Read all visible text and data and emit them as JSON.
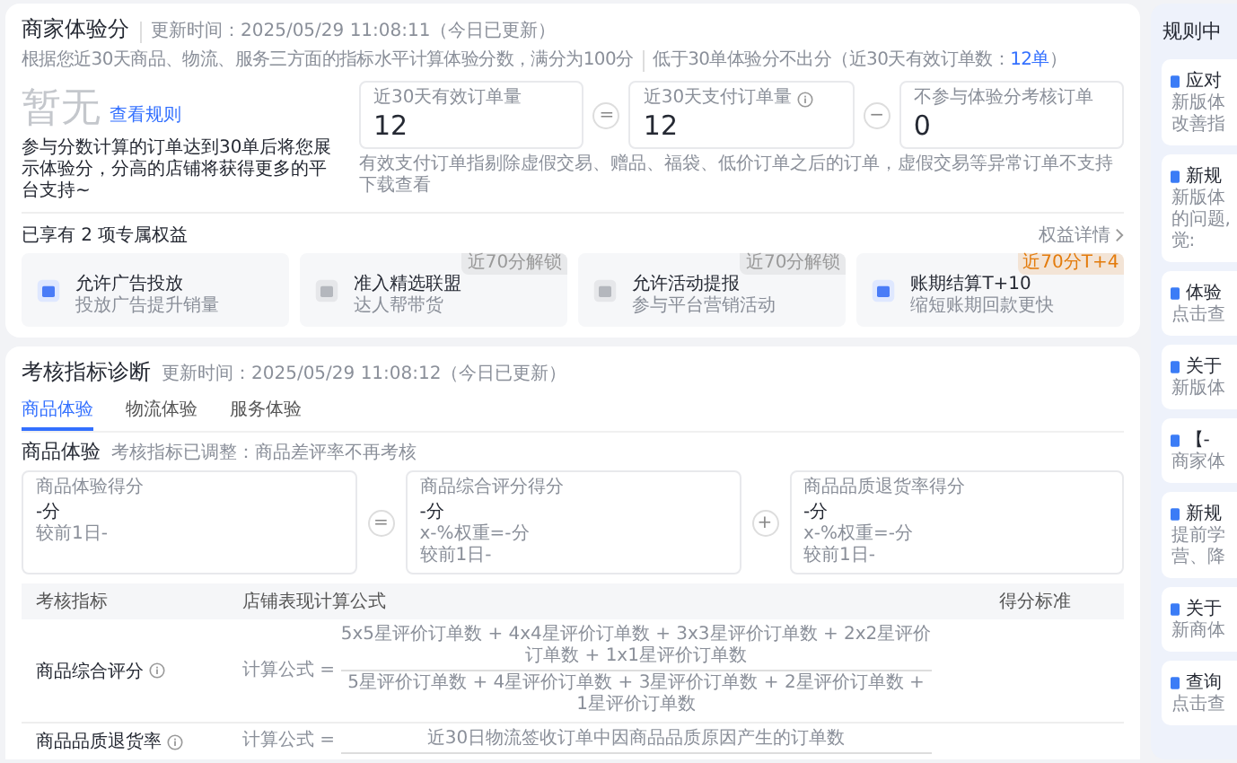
{
  "header": {
    "title": "商家体验分",
    "updated": "更新时间：2025/05/29 11:08:11（今日已更新）",
    "description": "根据您近30天商品、物流、服务三方面的指标水平计算体验分数，满分为100分",
    "threshold": "低于30单体验分不出分（近30天有效订单数：",
    "threshold_link": "12单",
    "threshold_end": "）"
  },
  "score": {
    "value": "暂无",
    "rules_link": "查看规则",
    "note": "参与分数计算的订单达到30单后将您展示体验分，分高的店铺将获得更多的平台支持~"
  },
  "order_formula": {
    "terms": [
      {
        "label": "近30天有效订单量",
        "value": "12",
        "info": false
      },
      {
        "label": "近30天支付订单量",
        "value": "12",
        "info": true
      },
      {
        "label": "不参与体验分考核订单",
        "value": "0",
        "info": false
      }
    ],
    "operators": [
      "=",
      "−"
    ],
    "note": "有效支付订单指剔除虚假交易、赠品、福袋、低价订单之后的订单，虚假交易等异常订单不支持下载查看"
  },
  "benefits": {
    "title": "已享有 2 项专属权益",
    "details_link": "权益详情",
    "items": [
      {
        "title": "允许广告投放",
        "desc": "投放广告提升销量",
        "unlocked": true
      },
      {
        "title": "准入精选联盟",
        "desc": "达人帮带货",
        "unlocked": false,
        "badge": "近70分解锁",
        "color": "#999999"
      },
      {
        "title": "允许活动提报",
        "desc": "参与平台营销活动",
        "unlocked": false,
        "badge": "近70分解锁",
        "color": "#999999"
      },
      {
        "title": "账期结算T+10",
        "desc": "缩短账期回款更快",
        "unlocked": true,
        "badge": "近70分T+4",
        "color": "#e37b0c"
      }
    ]
  },
  "diagnosis": {
    "title": "考核指标诊断",
    "updated": "更新时间：2025/05/29 11:08:12（今日已更新）",
    "tabs": [
      {
        "label": "商品体验",
        "selected": true
      },
      {
        "label": "物流体验",
        "selected": false
      },
      {
        "label": "服务体验",
        "selected": false
      }
    ],
    "section_title": "商品体验",
    "section_note": "考核指标已调整：商品差评率不再考核",
    "scores": [
      {
        "label": "商品体验得分",
        "value": "-分",
        "compare": "较前1日-"
      },
      {
        "label": "商品综合评分得分",
        "value": "-分",
        "weight": "x-%权重=-分",
        "compare": "较前1日-"
      },
      {
        "label": "商品品质退货率得分",
        "value": "-分",
        "weight": "x-%权重=-分",
        "compare": "较前1日-"
      }
    ],
    "operators": [
      "=",
      "+"
    ],
    "table": {
      "columns": [
        "考核指标",
        "店铺表现计算公式",
        "得分标准"
      ],
      "rows": [
        {
          "metric": "商品综合评分",
          "info": true,
          "formula_label": "计算公式 =",
          "numerator": "5x5星评价订单数 + 4x4星评价订单数 + 3x3星评价订单数 + 2x2星评价订单数 + 1x1星评价订单数",
          "denominator": "5星评价订单数 + 4星评价订单数 + 3星评价订单数 + 2星评价订单数 + 1星评价订单数"
        },
        {
          "metric": "商品品质退货率",
          "info": true,
          "formula_label": "计算公式 =",
          "numerator": "近30日物流签收订单中因商品品质原因产生的订单数"
        }
      ]
    }
  },
  "sidebar": {
    "title": "规则中",
    "items": [
      {
        "title": "应对",
        "lines": [
          "新版体",
          "改善指"
        ]
      },
      {
        "title": "新规",
        "lines": [
          "新版体",
          "的问题,",
          "觉:"
        ]
      },
      {
        "title": "体验",
        "lines": [
          "点击查"
        ]
      },
      {
        "title": "关于",
        "lines": [
          "新版体"
        ]
      },
      {
        "title": "【-",
        "lines": [
          "商家体"
        ]
      },
      {
        "title": "新规",
        "lines": [
          "提前学",
          "营、降"
        ]
      },
      {
        "title": "关于",
        "lines": [
          "新商体"
        ]
      },
      {
        "title": "查询",
        "lines": [
          "点击查"
        ]
      }
    ]
  }
}
